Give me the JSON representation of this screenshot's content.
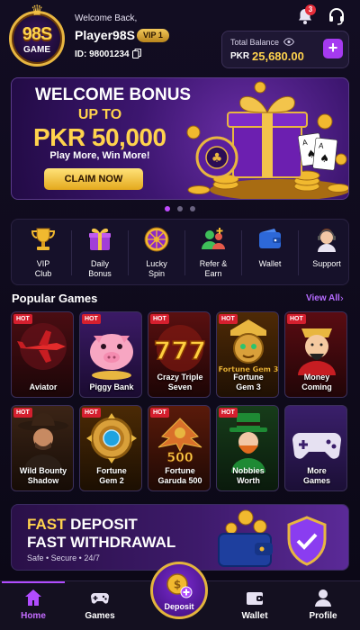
{
  "logo": {
    "top": "98S",
    "bottom": "GAME"
  },
  "user": {
    "greeting": "Welcome Back,",
    "name": "Player98S",
    "vip": "VIP 1",
    "id": "ID: 98001234"
  },
  "notifications": {
    "count": "3"
  },
  "balance": {
    "label": "Total Balance",
    "currency": "PKR",
    "amount": "25,680.00",
    "add": "+"
  },
  "banner": {
    "line1": "WELCOME BONUS",
    "line2": "UP TO",
    "line3": "PKR 50,000",
    "line4": "Play More, Win More!",
    "cta": "CLAIM NOW"
  },
  "carousel": {
    "pages": 3,
    "active": 0
  },
  "quick_menu": [
    {
      "label": "VIP\nClub",
      "icon": "trophy-icon"
    },
    {
      "label": "Daily\nBonus",
      "icon": "gift-icon"
    },
    {
      "label": "Lucky\nSpin",
      "icon": "wheel-icon"
    },
    {
      "label": "Refer &\nEarn",
      "icon": "refer-icon"
    },
    {
      "label": "Wallet",
      "icon": "wallet-icon"
    },
    {
      "label": "Support",
      "icon": "support-icon"
    }
  ],
  "popular": {
    "title": "Popular Games",
    "view_all": "View All",
    "hot_label": "HOT",
    "games": [
      {
        "name": "Aviator",
        "hot": true,
        "icon": "plane-icon"
      },
      {
        "name": "Piggy Bank",
        "hot": true,
        "icon": "piggy-icon"
      },
      {
        "name": "Crazy Triple\nSeven",
        "hot": true,
        "icon": "777-icon"
      },
      {
        "name": "Fortune\nGem 3",
        "hot": true,
        "icon": "idol-icon",
        "art_text": "Fortune Gem 3"
      },
      {
        "name": "Money\nComing",
        "hot": true,
        "icon": "god-of-wealth-icon"
      },
      {
        "name": "Wild Bounty\nShadow",
        "hot": true,
        "icon": "cowboy-icon"
      },
      {
        "name": "Fortune\nGem 2",
        "hot": true,
        "icon": "gem-icon"
      },
      {
        "name": "Fortune\nGaruda 500",
        "hot": true,
        "icon": "garuda-icon",
        "art_text": "500"
      },
      {
        "name": "Nobbies\nWorth",
        "hot": true,
        "icon": "leprechaun-icon"
      },
      {
        "name": "More\nGames",
        "hot": false,
        "icon": "gamepad-icon"
      }
    ]
  },
  "deposit_banner": {
    "fast": "FAST",
    "line1_rest": " DEPOSIT",
    "line2": "FAST WITHDRAWAL",
    "line3": "Safe • Secure • 24/7"
  },
  "bottom_nav": [
    {
      "label": "Home",
      "active": true
    },
    {
      "label": "Games",
      "active": false
    },
    {
      "label": "Deposit",
      "active": false
    },
    {
      "label": "Wallet",
      "active": false
    },
    {
      "label": "Profile",
      "active": false
    }
  ],
  "colors": {
    "accent": "#a53af0",
    "gold": "#ffd34d",
    "hot": "#d41f2e",
    "bg": "#0d0a1a"
  }
}
